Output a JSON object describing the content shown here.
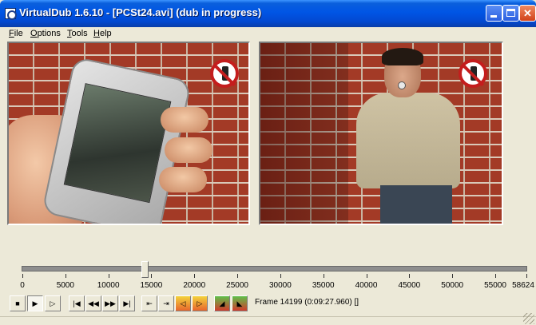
{
  "window": {
    "title": "VirtualDub 1.6.10 - [PCSt24.avi] (dub in progress)",
    "icon": "virtualdub-app-icon",
    "controls": {
      "minimize": "minimize-icon",
      "maximize": "maximize-icon",
      "close": "close-icon"
    }
  },
  "menu": {
    "items": [
      {
        "hot": "F",
        "rest": "ile"
      },
      {
        "hot": "O",
        "rest": "ptions"
      },
      {
        "hot": "T",
        "rest": "ools"
      },
      {
        "hot": "H",
        "rest": "elp"
      }
    ]
  },
  "panes": {
    "input": {
      "name": "input-video-pane",
      "icon": "no-cellphone-icon"
    },
    "output": {
      "name": "output-video-pane",
      "icon": "no-cellphone-icon"
    }
  },
  "timeline": {
    "tick_labels": [
      "0",
      "5000",
      "10000",
      "15000",
      "20000",
      "25000",
      "30000",
      "35000",
      "40000",
      "45000",
      "50000",
      "55000",
      "58624"
    ],
    "max_frame": 58624,
    "current_frame": 14199
  },
  "toolbar": {
    "buttons": [
      {
        "icon": "stop-icon",
        "state": "normal"
      },
      {
        "icon": "play-input-icon",
        "state": "pressed"
      },
      {
        "icon": "play-output-icon",
        "state": "normal"
      },
      {
        "icon": "go-start-icon",
        "state": "normal"
      },
      {
        "icon": "step-back-icon",
        "state": "normal"
      },
      {
        "icon": "step-forward-icon",
        "state": "normal"
      },
      {
        "icon": "go-end-icon",
        "state": "normal"
      },
      {
        "icon": "prev-keyframe-icon",
        "state": "normal"
      },
      {
        "icon": "next-keyframe-icon",
        "state": "normal"
      },
      {
        "icon": "scene-back-icon",
        "state": "normal"
      },
      {
        "icon": "scene-forward-icon",
        "state": "normal"
      },
      {
        "icon": "mark-in-icon",
        "state": "normal"
      },
      {
        "icon": "mark-out-icon",
        "state": "normal"
      }
    ],
    "frame_readout": "Frame 14199 (0:09:27.960) []"
  },
  "colors": {
    "titlebar": "#0055e5",
    "window_bg": "#ece9d8",
    "slider_track": "#8e8e8e"
  }
}
